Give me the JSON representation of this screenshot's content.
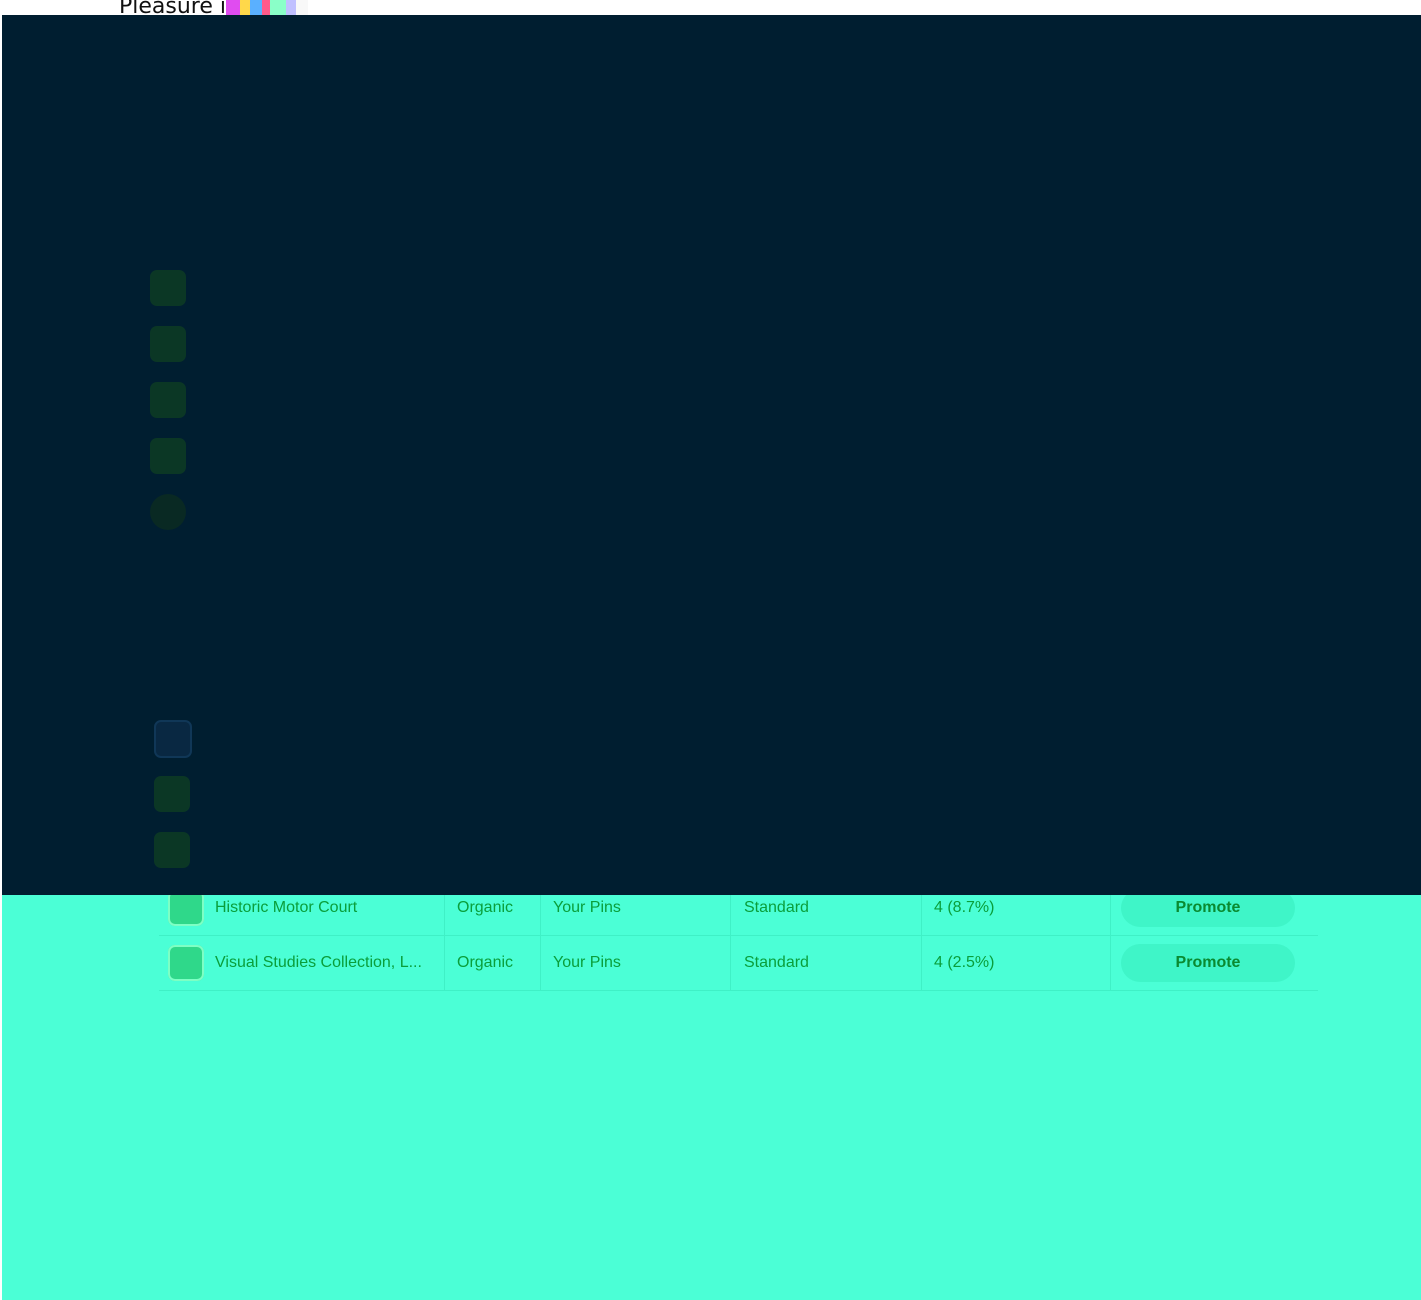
{
  "header": {
    "caption": "Pleasure in"
  },
  "pins_table": {
    "rows": [
      {
        "title": "Historic Motor Court",
        "source": "Organic",
        "account": "Your Pins",
        "format": "Standard",
        "metric": "4 (8.7%)",
        "action_label": "Promote"
      },
      {
        "title": "Visual Studies Collection, L...",
        "source": "Organic",
        "account": "Your Pins",
        "format": "Standard",
        "metric": "4 (2.5%)",
        "action_label": "Promote"
      }
    ]
  },
  "colors": {
    "overlay": "#001e30",
    "background": "#4bffd6",
    "text": "#0a9e3a",
    "button": "#3ff5c8"
  }
}
